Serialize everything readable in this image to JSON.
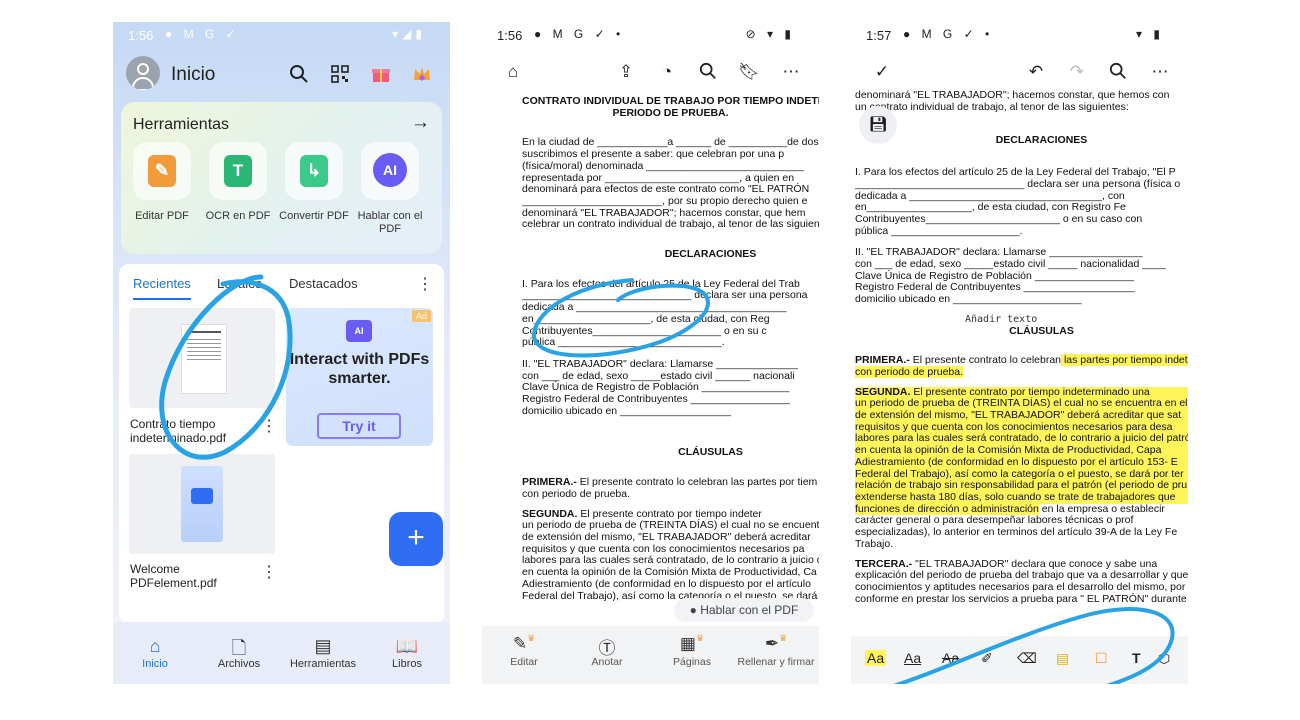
{
  "colors": {
    "accent": "#1a73e8",
    "fab": "#2f6df2",
    "highlight": "#fff45a",
    "annotation_stroke": "#2aa3e4"
  },
  "screen1": {
    "status": {
      "time": "1:56"
    },
    "header": {
      "title": "Inicio"
    },
    "tools": {
      "title": "Herramientas",
      "items": [
        {
          "label": "Editar PDF",
          "icon": "edit-pdf-icon",
          "color": "#f29b3a"
        },
        {
          "label": "OCR en PDF",
          "icon": "ocr-icon",
          "color": "#2bb673"
        },
        {
          "label": "Convertir PDF",
          "icon": "convert-icon",
          "color": "#3cc98b"
        },
        {
          "label": "Hablar con el PDF",
          "icon": "ai-chat-icon",
          "color": "#6a5cf3"
        }
      ]
    },
    "tabs": [
      "Recientes",
      "Locales",
      "Destacados"
    ],
    "files": [
      {
        "name": "Contrato tiempo indeterminado.pdf"
      },
      {
        "name": "Welcome PDFelement.pdf"
      }
    ],
    "ad": {
      "badge": "Ad",
      "logo": "AI",
      "text": "Interact with PDFs smarter.",
      "button": "Try it"
    },
    "nav": [
      "Inicio",
      "Archivos",
      "Herramientas",
      "Libros"
    ]
  },
  "screen2": {
    "status": {
      "time": "1:56"
    },
    "doc": {
      "title1": "CONTRATO INDIVIDUAL DE TRABAJO POR TIEMPO INDETE",
      "title2": "PERIODO DE PRUEBA.",
      "p1": [
        "En la ciudad de ____________a ______ de __________de dos mi",
        "suscribimos el presente a saber: que celebran por una p",
        "(física/moral)  denominada  ___________________________",
        "representada por  _______________________, a quien en",
        "denominará para efectos de este contrato como \"EL PATRÓN",
        "________________________, por su propio derecho quien e",
        "denominará \"EL TRABAJADOR\"; hacemos constar,  que hem",
        "celebrar un contrato individual de trabajo, al tenor de las siguiente"
      ],
      "h_decl": "DECLARACIONES",
      "decl_i": [
        "I.     Para los efectos del artículo 25 de la Ley Federal del Trab",
        "        _____________________________ declara  ser una persona",
        "        dedicada a  ____________________________________",
        "        en____________________, de esta ciudad, con Reg",
        "        Contribuyentes______________________ o en su c",
        "        pública ____________________________."
      ],
      "decl_ii": [
        "II.    \"EL TRABAJADOR\" declara: Llamarse ______________",
        "        con ___ de edad, sexo _____estado civil ______ nacionali",
        "        Clave Única de Registro de Población _______________",
        "        Registro Federal de Contribuyentes _________________",
        "        domicilio ubicado en ___________________"
      ],
      "h_claus": "CLÁUSULAS",
      "primera_label": "PRIMERA.-",
      "primera": [
        " El presente contrato lo celebran las partes por tiem",
        "con periodo de prueba."
      ],
      "segunda_label": "SEGUNDA.",
      "segunda": [
        "    El    presente    contrato    por    tiempo    indeter",
        "un periodo de prueba de (TREINTA DÍAS) el cual no se encuent",
        "de extensión del mismo, \"EL TRABAJADOR\" deberá acreditar",
        "requisitos y  que cuenta con los conocimientos necesarios pa",
        "labores para las cuales será contratado, de lo contrario a juicio de",
        "en cuenta la opinión de la Comisión Mixta de Productividad, Ca",
        "Adiestramiento (de conformidad en lo dispuesto por el artículo",
        "Federal del Trabajo), así como la categoría o el puesto, se dará"
      ]
    },
    "chat_pill": "Hablar con el PDF",
    "bottom": [
      "Editar",
      "Anotar",
      "Páginas",
      "Rellenar y firmar"
    ]
  },
  "screen3": {
    "status": {
      "time": "1:57"
    },
    "doc": {
      "top": [
        "denominará \"EL TRABAJADOR\"; hacemos constar,  que hemos con",
        "        un contrato individual de trabajo, al tenor de las siguientes:"
      ],
      "h_decl": "DECLARACIONES",
      "decl_i": [
        "I.     Para los efectos del artículo 25 de la Ley Federal del Trabajo, \"El P",
        "        _____________________________ declara  ser una persona (física o",
        "        dedicada a  _________________________________, con",
        "        en__________________, de esta ciudad, con Registro Fe",
        "        Contribuyentes_______________________ o en su caso con",
        "        pública ______________________."
      ],
      "decl_ii": [
        "II.    \"EL TRABAJADOR\" declara: Llamarse ________________",
        "        con ___ de edad, sexo _____estado civil _____ nacionalidad ____",
        "        Clave Única de Registro de Población _________________",
        "        Registro Federal de Contribuyentes ___________________",
        "        domicilio ubicado en ______________________"
      ],
      "add_text": "Añadir texto",
      "h_claus": "CLÁUSULAS",
      "primera_label": "PRIMERA.-",
      "primera_plain": " El presente contrato lo celebran",
      "primera_hl": " las partes por tiempo indet",
      "primera_hl2": "con periodo de prueba.",
      "segunda_label": "SEGUNDA.",
      "segunda_hl": [
        "    El    presente    contrato    por    tiempo    indeterminado    una",
        "un periodo de prueba de (TREINTA DÍAS) el cual no se encuentra en el",
        "de extensión del mismo, \"EL TRABAJADOR\" deberá acreditar que sat",
        "requisitos y  que cuenta con los conocimientos necesarios para desa",
        "labores para las cuales será contratado, de lo contrario a juicio del patrón",
        "en cuenta la opinión de la Comisión Mixta de Productividad, Capa",
        "Adiestramiento (de conformidad en lo dispuesto por el artículo 153- E",
        "Federal del Trabajo), así como la categoría o el puesto, se dará por ter",
        "relación de trabajo sin responsabilidad para el patrón (el periodo de pru",
        "extenderse hasta 180 días, solo cuando se trate de trabajadores que",
        "funciones de dirección o administración"
      ],
      "segunda_rest": [
        " en la empresa o establecir",
        "carácter  general  o  para  desempeñar  labores  técnicas  o  prof",
        "especializadas), lo anterior en terminos del artículo 39-A de la Ley Fe",
        "Trabajo."
      ],
      "tercera_label": "TERCERA.-",
      "tercera": [
        "     \"EL TRABAJADOR\" declara que conoce y sabe una",
        "explicación del periodo de prueba del trabajo que va a desarrollar y que",
        "conocimientos y aptitudes necesarios para el desarrollo del mismo, por lo",
        "conforme en prestar los servicios a prueba para \" EL PATRÓN\" durante"
      ]
    },
    "anno_tools": [
      "Aa",
      "Aa",
      "Aa"
    ]
  }
}
